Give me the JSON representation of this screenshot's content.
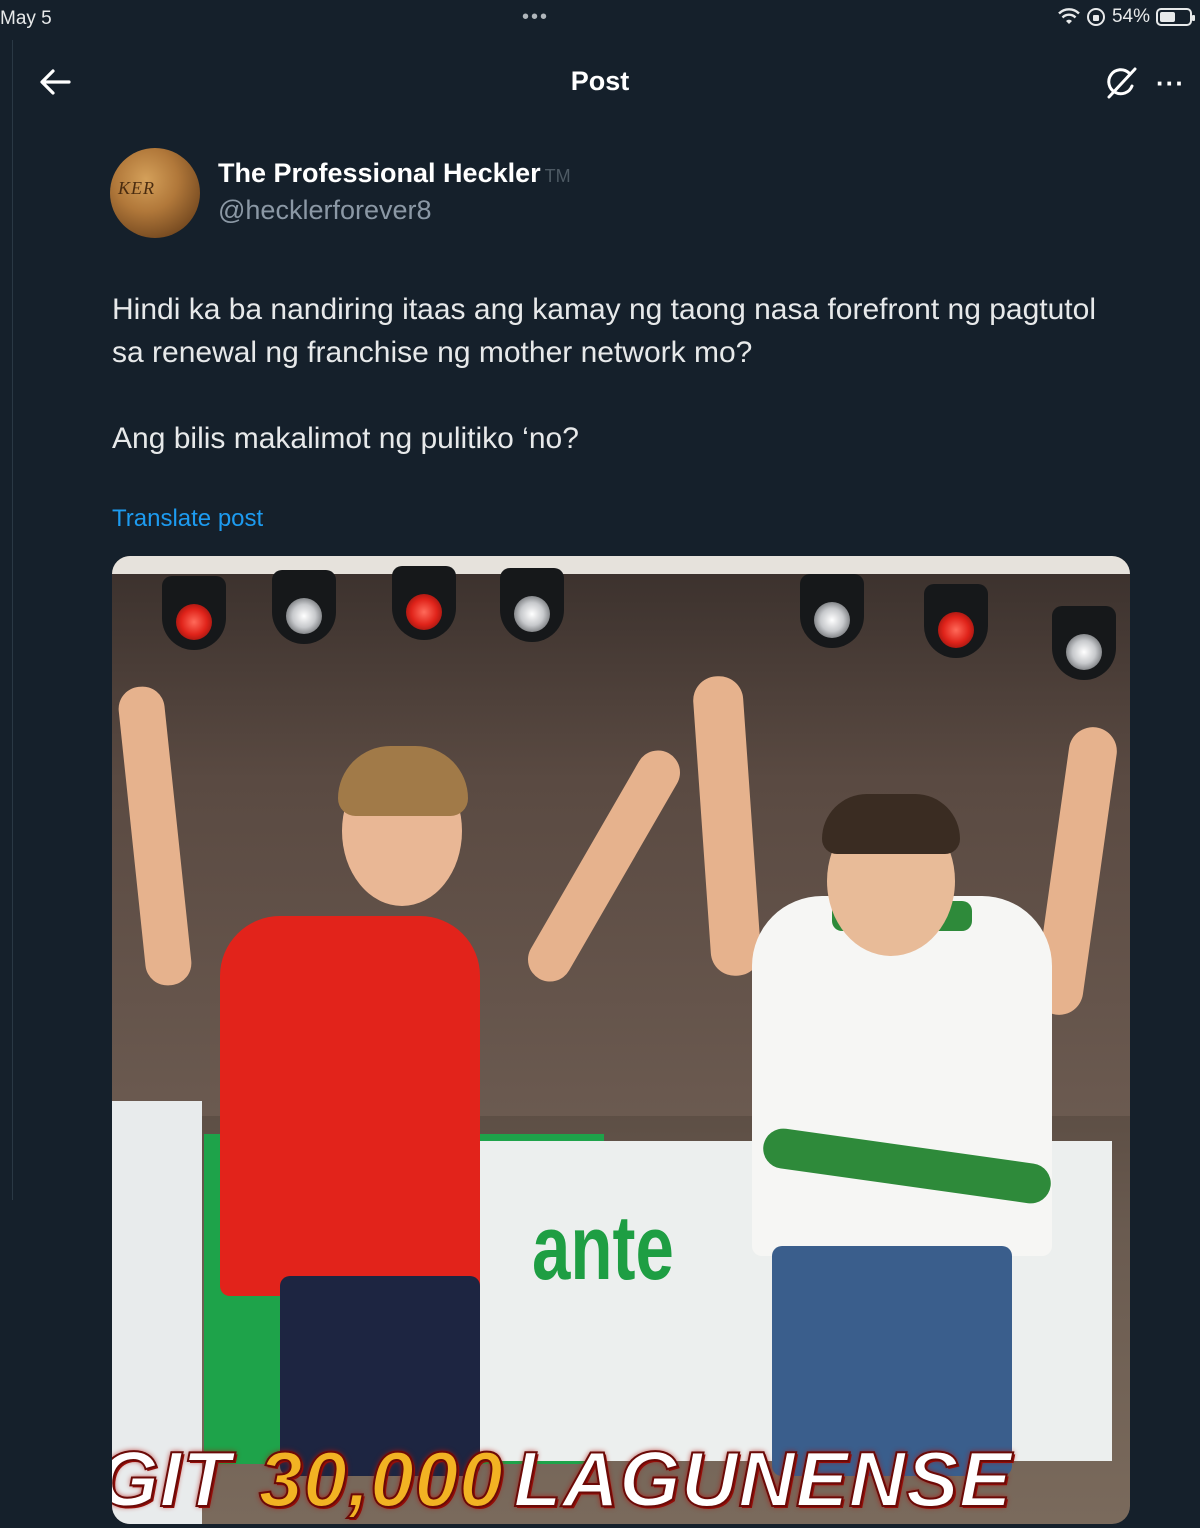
{
  "status_bar": {
    "date": "May 5",
    "dots": "•••",
    "battery": "54%",
    "battery_level": 0.54,
    "icons": [
      "wifi-icon",
      "orientation-lock-icon",
      "battery-icon"
    ]
  },
  "header": {
    "title": "Post",
    "back_icon": "arrow-left-icon",
    "grok_icon": "grok-icon",
    "more_label": "···"
  },
  "post": {
    "author_name": "The Professional Heckler",
    "author_tm": "TM",
    "author_handle": "@hecklerforever8",
    "avatar_text": "KER",
    "paragraph_1": "Hindi ka ba nandiring itaas ang kamay ng taong nasa forefront ng pagtutol sa renewal ng franchise ng mother network mo?",
    "paragraph_2": "Ang bilis makalimot ng pulitiko ‘no?",
    "translate_label": "Translate post"
  },
  "media": {
    "banner_text": "ante",
    "caption_prefix": "GIT",
    "caption_number": "30,000",
    "caption_word": "LAGUNENSE"
  },
  "colors": {
    "background": "#15202b",
    "link": "#1d9bf0",
    "handle": "#8b98a5"
  }
}
